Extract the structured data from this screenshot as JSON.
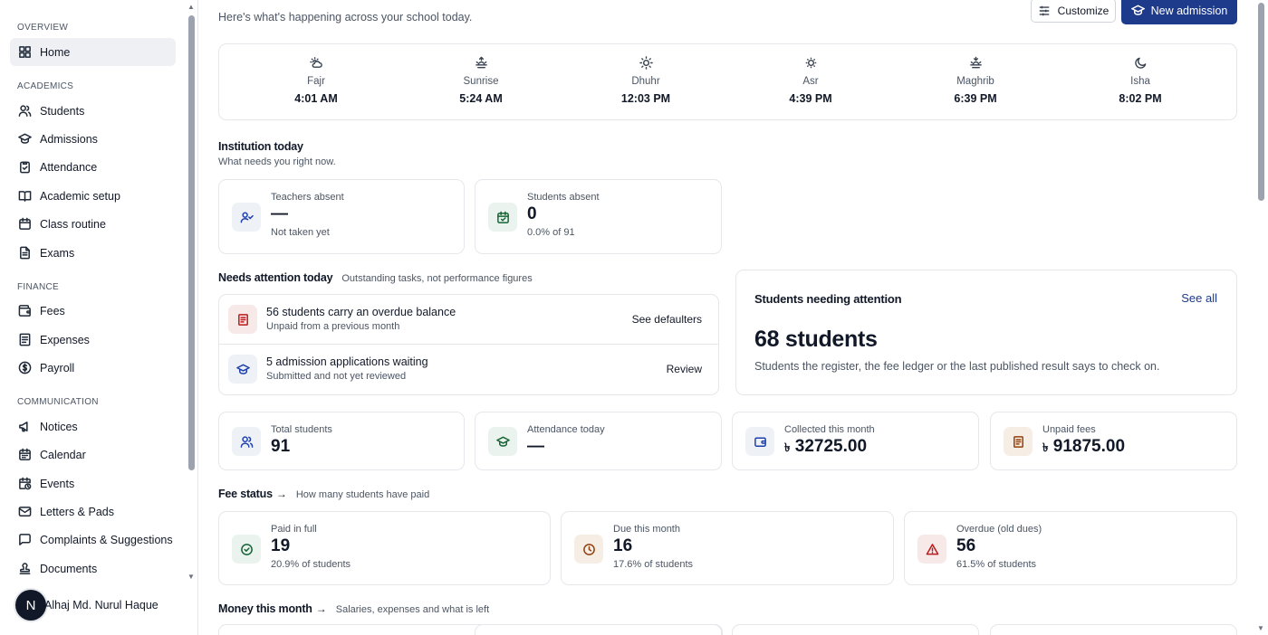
{
  "sidebar": {
    "sections": [
      {
        "title": "OVERVIEW",
        "items": [
          {
            "label": "Home",
            "icon": "grid-icon",
            "active": true
          }
        ]
      },
      {
        "title": "ACADEMICS",
        "items": [
          {
            "label": "Students",
            "icon": "users-icon"
          },
          {
            "label": "Admissions",
            "icon": "graduation-cap-icon"
          },
          {
            "label": "Attendance",
            "icon": "clipboard-check-icon"
          },
          {
            "label": "Academic setup",
            "icon": "book-open-icon"
          },
          {
            "label": "Class routine",
            "icon": "calendar-icon"
          },
          {
            "label": "Exams",
            "icon": "file-text-icon"
          }
        ]
      },
      {
        "title": "FINANCE",
        "items": [
          {
            "label": "Fees",
            "icon": "wallet-icon"
          },
          {
            "label": "Expenses",
            "icon": "receipt-icon"
          },
          {
            "label": "Payroll",
            "icon": "dollar-circle-icon"
          }
        ]
      },
      {
        "title": "COMMUNICATION",
        "items": [
          {
            "label": "Notices",
            "icon": "megaphone-icon"
          },
          {
            "label": "Calendar",
            "icon": "calendar-days-icon"
          },
          {
            "label": "Events",
            "icon": "calendar-clock-icon"
          },
          {
            "label": "Letters & Pads",
            "icon": "mail-icon"
          },
          {
            "label": "Complaints & Suggestions",
            "icon": "message-square-icon"
          },
          {
            "label": "Documents",
            "icon": "stamp-icon"
          }
        ]
      }
    ],
    "user": {
      "initial": "N",
      "name": "Alhaj Md. Nurul Haque"
    }
  },
  "header": {
    "subtitle": "Here's what's happening across your school today.",
    "customize_label": "Customize",
    "new_admission_label": "New admission"
  },
  "prayers": [
    {
      "name": "Fajr",
      "time": "4:01 AM",
      "icon": "cloud-sun-icon"
    },
    {
      "name": "Sunrise",
      "time": "5:24 AM",
      "icon": "sunrise-icon"
    },
    {
      "name": "Dhuhr",
      "time": "12:03 PM",
      "icon": "sun-icon"
    },
    {
      "name": "Asr",
      "time": "4:39 PM",
      "icon": "sun-dim-icon"
    },
    {
      "name": "Maghrib",
      "time": "6:39 PM",
      "icon": "sunset-icon"
    },
    {
      "name": "Isha",
      "time": "8:02 PM",
      "icon": "moon-icon"
    }
  ],
  "institution": {
    "title": "Institution today",
    "subtitle": "What needs you right now.",
    "teachers_absent": {
      "label": "Teachers absent",
      "value": "—",
      "sub": "Not taken yet"
    },
    "students_absent": {
      "label": "Students absent",
      "value": "0",
      "sub": "0.0% of 91"
    }
  },
  "needs_attention": {
    "title": "Needs attention today",
    "subtitle": "Outstanding tasks, not performance figures",
    "tasks": [
      {
        "title": "56 students carry an overdue balance",
        "sub": "Unpaid from a previous month",
        "action": "See defaulters"
      },
      {
        "title": "5 admission applications waiting",
        "sub": "Submitted and not yet reviewed",
        "action": "Review"
      }
    ]
  },
  "students_attention": {
    "title": "Students needing attention",
    "link": "See all",
    "value": "68 students",
    "description": "Students the register, the fee ledger or the last published result says to check on."
  },
  "summary": [
    {
      "label": "Total students",
      "value": "91"
    },
    {
      "label": "Attendance today",
      "value": "—"
    },
    {
      "label": "Collected this month",
      "currency": "৳",
      "value": "32725.00"
    },
    {
      "label": "Unpaid fees",
      "currency": "৳",
      "value": "91875.00"
    }
  ],
  "fee_status": {
    "title": "Fee status",
    "arrow": "→",
    "subtitle": "How many students have paid",
    "cards": [
      {
        "label": "Paid in full",
        "value": "19",
        "sub": "20.9% of students"
      },
      {
        "label": "Due this month",
        "value": "16",
        "sub": "17.6% of students"
      },
      {
        "label": "Overdue (old dues)",
        "value": "56",
        "sub": "61.5% of students"
      }
    ]
  },
  "money": {
    "title": "Money this month",
    "arrow": "→",
    "subtitle": "Salaries, expenses and what is left"
  },
  "colors": {
    "accent": "#1e3a8a",
    "active_bar": "#1e40af"
  }
}
